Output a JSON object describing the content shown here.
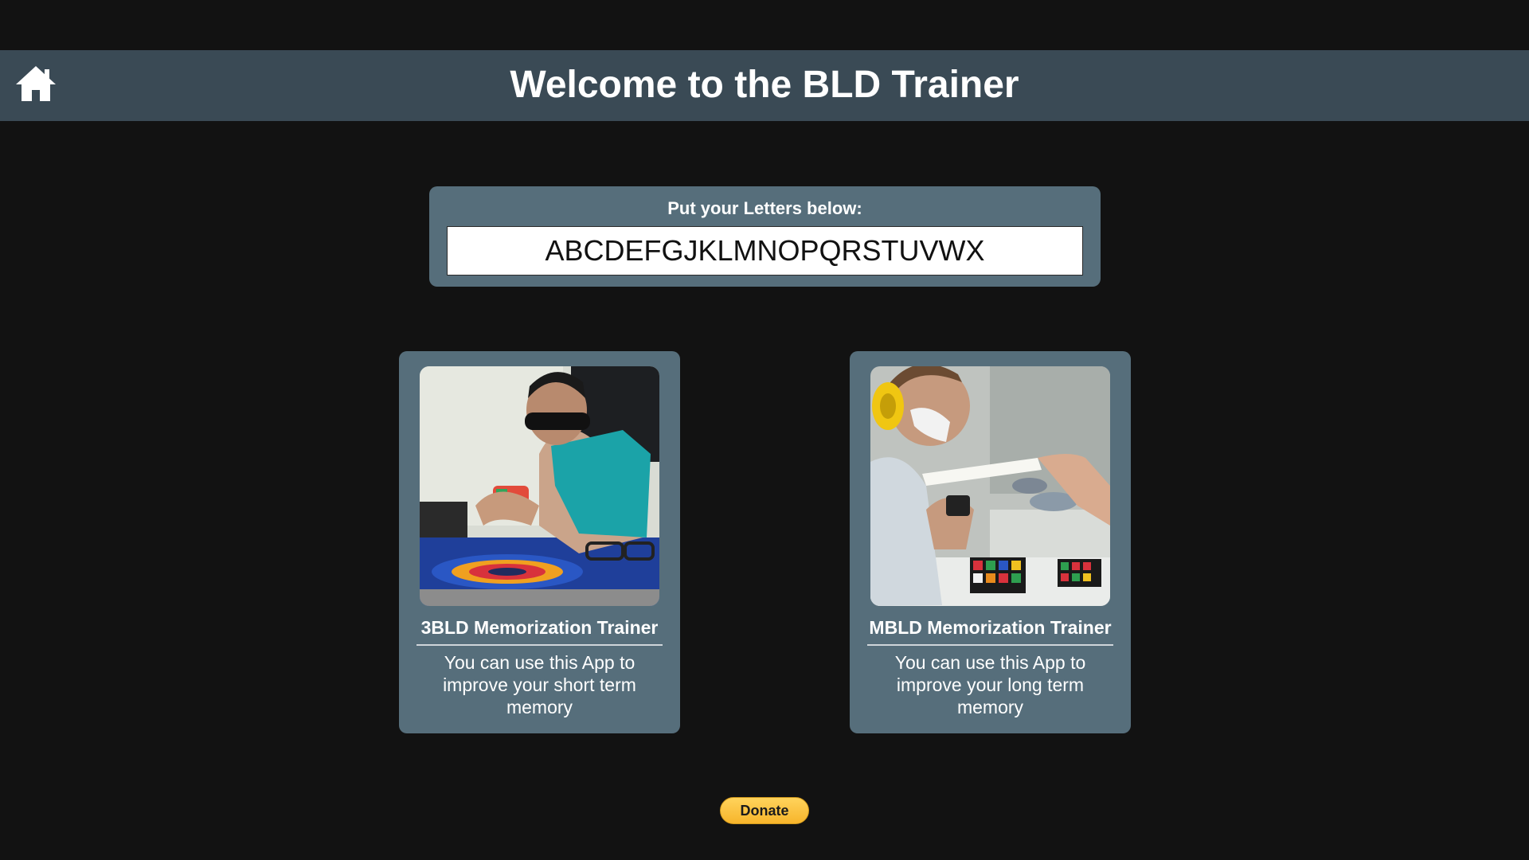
{
  "header": {
    "title": "Welcome to the BLD Trainer",
    "home_icon": "home-icon"
  },
  "letters": {
    "label": "Put your Letters below:",
    "value": "ABCDEFGJKLMNOPQRSTUVWX"
  },
  "cards": [
    {
      "title": "3BLD Memorization Trainer",
      "description": "You can use this App to improve your short term memory",
      "image": "photo-blindfolded-cuber-solving"
    },
    {
      "title": "MBLD Memorization Trainer",
      "description": "You can use this App to improve your long term memory",
      "image": "photo-blindfolded-cuber-with-earmuffs"
    }
  ],
  "donate": {
    "label": "Donate"
  },
  "colors": {
    "background": "#121212",
    "header": "#3a4a55",
    "panel": "#566e7b",
    "donate": "#f7b52b"
  }
}
